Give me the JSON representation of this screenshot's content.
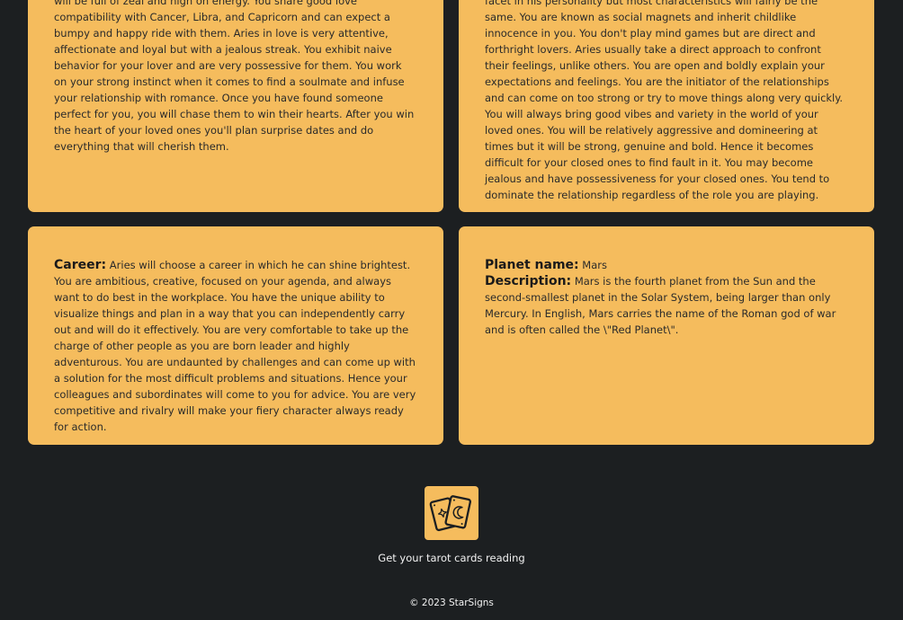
{
  "love": {
    "left_text": "will be full of zeal and high on energy. You share good love compatibility with Cancer, Libra, and Capricorn and can expect a bumpy and happy ride with them. Aries in love is very attentive, affectionate and loyal but with a jealous streak. You exhibit naive behavior for your lover and are very possessive for them. You work on your strong instinct when it comes to find a soulmate and infuse your relationship with romance. Once you have found someone perfect for you, you will chase them to win their hearts. After you win the heart of your loved ones you'll plan surprise dates and do everything that will cherish them.",
    "right_text": "facet in his personality but most characteristics will fairly be the same. You are known as social magnets and inherit childlike innocence in you. You don't play mind games but are direct and forthright lovers. Aries usually take a direct approach to confront their feelings, unlike others. You are open and boldly explain your expectations and feelings. You are the initiator of the relationships and can come on too strong or try to move things along very quickly. You will always bring good vibes and variety in the world of your loved ones. You will be relatively aggressive and domineering at times but it will be strong, genuine and bold. Hence it becomes difficult for your closed ones to find fault in it. You may become jealous and have possessiveness for your closed ones. You tend to dominate the relationship regardless of the role you are playing."
  },
  "career": {
    "label": "Career:",
    "text": "Aries will choose a career in which he can shine brightest. You are ambitious, creative, focused on your agenda, and always want to do best in the workplace. You have the unique ability to visualize things and plan in a way that you can independently carry out and will do it effectively. You are very comfortable to take up the charge of other people as you are born leader and highly adventurous. You are undaunted by challenges and can come up with a solution for the most difficult problems and situations. Hence your colleagues and subordinates will come to you for advice. You are very competitive and rivalry will make your fiery character always ready for action."
  },
  "planet": {
    "name_label": "Planet name:",
    "name": "Mars",
    "desc_label": "Description:",
    "description": "Mars is the fourth planet from the Sun and the second-smallest planet in the Solar System, being larger than only Mercury. In English, Mars carries the name of the Roman god of war and is often called the \\\"Red Planet\\\"."
  },
  "footer": {
    "tarot_icon": "tarot-cards-icon",
    "tarot_link": "Get your tarot cards reading",
    "copyright": "© 2023 StarSigns"
  },
  "colors": {
    "background": "#1c1f21",
    "card": "#f5bc5d",
    "text": "#2a2a2a",
    "footer_text": "#f2f2f2"
  }
}
